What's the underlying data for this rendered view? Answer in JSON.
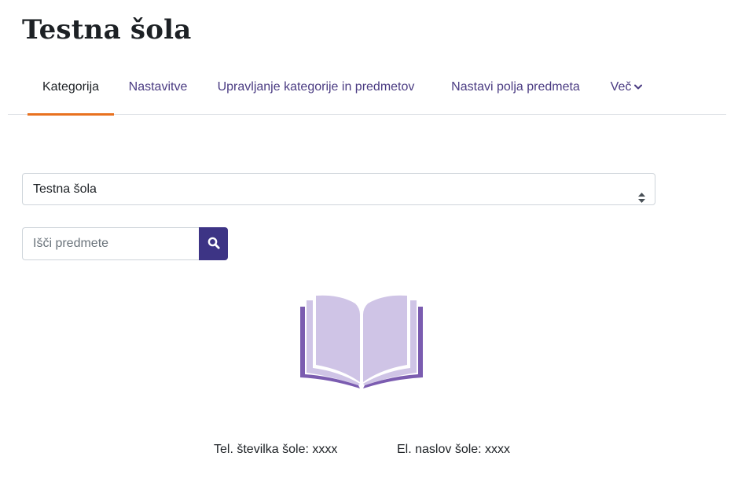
{
  "page": {
    "title": "Testna šola"
  },
  "nav": {
    "tabs": [
      {
        "label": "Kategorija",
        "active": true
      },
      {
        "label": "Nastavitve",
        "active": false
      },
      {
        "label": "Upravljanje kategorije in predmetov",
        "active": false
      },
      {
        "label": "Nastavi polja predmeta",
        "active": false
      },
      {
        "label": "Več",
        "active": false,
        "icon": "chevron-down-icon"
      }
    ]
  },
  "category_select": {
    "selected": "Testna šola",
    "icon": "sort-arrows-icon"
  },
  "search": {
    "placeholder": "Išči predmete",
    "value": "",
    "button_icon": "search-icon"
  },
  "illustration": {
    "icon": "open-book-icon",
    "colors": {
      "pages": "#cfc4e6",
      "cover": "#7b5cb0"
    }
  },
  "footer": {
    "phone_label": "Tel. številka šole: xxxx",
    "email_label": "El. naslov šole: xxxx"
  },
  "colors": {
    "accent_underline": "#e8711f",
    "link": "#4a3b82",
    "button_bg": "#3d3485"
  }
}
